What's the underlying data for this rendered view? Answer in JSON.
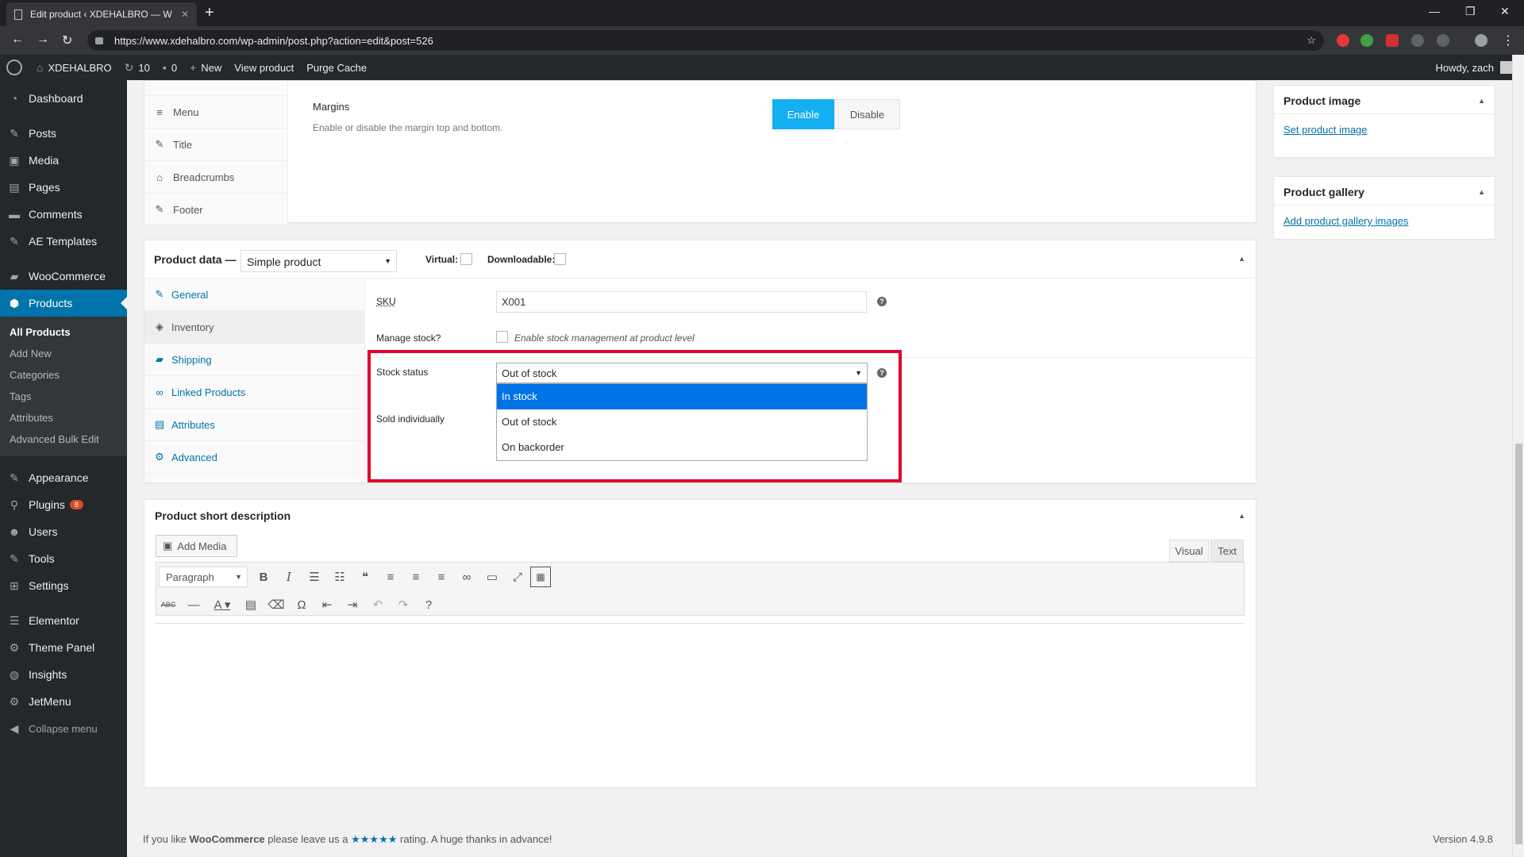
{
  "browser": {
    "tab_title": "Edit product ‹ XDEHALBRO — W",
    "url": "https://www.xdehalbro.com/wp-admin/post.php?action=edit&post=526"
  },
  "adminbar": {
    "site": "XDEHALBRO",
    "updates": "10",
    "comments": "0",
    "new": "New",
    "view_product": "View product",
    "purge_cache": "Purge Cache",
    "howdy": "Howdy, zach"
  },
  "sidebar": {
    "items": [
      {
        "label": "Dashboard",
        "icon": "dashboard-icon"
      },
      {
        "label": "Posts",
        "icon": "pin-icon"
      },
      {
        "label": "Media",
        "icon": "media-icon"
      },
      {
        "label": "Pages",
        "icon": "pages-icon"
      },
      {
        "label": "Comments",
        "icon": "comment-icon"
      },
      {
        "label": "AE Templates",
        "icon": "pin-icon"
      },
      {
        "label": "WooCommerce",
        "icon": "woocommerce-icon"
      },
      {
        "label": "Products",
        "icon": "products-icon"
      },
      {
        "label": "Appearance",
        "icon": "brush-icon"
      },
      {
        "label": "Plugins",
        "icon": "plugin-icon",
        "badge": "8"
      },
      {
        "label": "Users",
        "icon": "users-icon"
      },
      {
        "label": "Tools",
        "icon": "tools-icon"
      },
      {
        "label": "Settings",
        "icon": "settings-icon"
      },
      {
        "label": "Elementor",
        "icon": "elementor-icon"
      },
      {
        "label": "Theme Panel",
        "icon": "gear-icon"
      },
      {
        "label": "Insights",
        "icon": "insights-icon"
      },
      {
        "label": "JetMenu",
        "icon": "gear-icon"
      },
      {
        "label": "Collapse menu",
        "icon": "collapse-icon"
      }
    ],
    "products_sub": [
      "All Products",
      "Add New",
      "Categories",
      "Tags",
      "Attributes",
      "Advanced Bulk Edit"
    ]
  },
  "settings_box": {
    "tabs": [
      "Menu",
      "Title",
      "Breadcrumbs",
      "Footer"
    ],
    "margins_label": "Margins",
    "margins_desc": "Enable or disable the margin top and bottom.",
    "enable": "Enable",
    "disable": "Disable"
  },
  "product_data": {
    "heading": "Product data —",
    "type": "Simple product",
    "virtual": "Virtual:",
    "downloadable": "Downloadable:",
    "tabs": [
      "General",
      "Inventory",
      "Shipping",
      "Linked Products",
      "Attributes",
      "Advanced"
    ],
    "sku_label": "SKU",
    "sku_value": "X001",
    "manage_stock_label": "Manage stock?",
    "manage_stock_desc": "Enable stock management at product level",
    "stock_status_label": "Stock status",
    "stock_status_value": "Out of stock",
    "stock_options": [
      "In stock",
      "Out of stock",
      "On backorder"
    ],
    "sold_individually": "Sold individually"
  },
  "short_desc": {
    "heading": "Product short description",
    "add_media": "Add Media",
    "visual": "Visual",
    "text": "Text",
    "format": "Paragraph"
  },
  "side": {
    "product_image": "Product image",
    "set_image": "Set product image",
    "product_gallery": "Product gallery",
    "add_gallery": "Add product gallery images"
  },
  "footer": {
    "text1": "If you like",
    "brand": "WooCommerce",
    "text2": "please leave us a",
    "stars": "★★★★★",
    "text3": "rating. A huge thanks in advance!",
    "version": "Version 4.9.8"
  }
}
